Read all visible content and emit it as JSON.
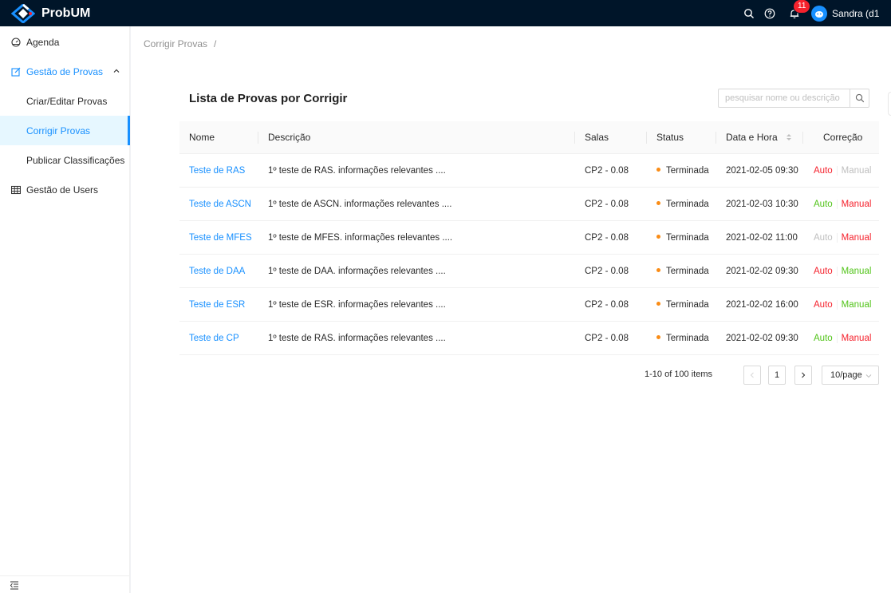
{
  "app": {
    "brand": "ProbUM",
    "user_name": "Sandra (d1",
    "notification_count": "11"
  },
  "colors": {
    "header_bg": "#001529",
    "primary": "#1890ff",
    "auto_red": "#f5222d",
    "manual_green": "#52c41a",
    "disabled": "#bfbfbf",
    "status_dot": "#fa8c16"
  },
  "sidebar": {
    "agenda": "Agenda",
    "gestao_provas": "Gestão de  Provas",
    "criar_editar": "Criar/Editar Provas",
    "corrigir": "Corrigir Provas",
    "publicar": "Publicar Classificações",
    "gestao_users": "Gestão de Users"
  },
  "breadcrumb": {
    "current": "Corrigir Provas",
    "separator": "/"
  },
  "list": {
    "title": "Lista de Provas por Corrigir",
    "search_placeholder": "pesquisar nome ou descrição"
  },
  "table": {
    "headers": {
      "nome": "Nome",
      "descricao": "Descrição",
      "salas": "Salas",
      "status": "Status",
      "data": "Data e Hora",
      "correcao": "Correção"
    },
    "rows": [
      {
        "nome": "Teste de RAS",
        "descricao": "1º teste de RAS. informações relevantes ....",
        "salas": "CP2 - 0.08",
        "status": "Terminada",
        "data": "2021-02-05 09:30",
        "auto": "Auto",
        "manual": "Manual",
        "auto_state": "red",
        "manual_state": "disabled"
      },
      {
        "nome": "Teste de ASCN",
        "descricao": "1º teste de ASCN. informações relevantes ....",
        "salas": "CP2 - 0.08",
        "status": "Terminada",
        "data": "2021-02-03 10:30",
        "auto": "Auto",
        "manual": "Manual",
        "auto_state": "green",
        "manual_state": "red"
      },
      {
        "nome": "Teste de  MFES",
        "descricao": "1º teste de MFES. informações relevantes ....",
        "salas": "CP2 - 0.08",
        "status": "Terminada",
        "data": "2021-02-02 11:00",
        "auto": "Auto",
        "manual": "Manual",
        "auto_state": "disabled",
        "manual_state": "red"
      },
      {
        "nome": "Teste de DAA",
        "descricao": "1º teste de DAA. informações relevantes ....",
        "salas": "CP2 - 0.08",
        "status": "Terminada",
        "data": "2021-02-02 09:30",
        "auto": "Auto",
        "manual": "Manual",
        "auto_state": "red",
        "manual_state": "green"
      },
      {
        "nome": "Teste de ESR",
        "descricao": "1º teste de ESR. informações relevantes ....",
        "salas": "CP2 - 0.08",
        "status": "Terminada",
        "data": "2021-02-02 16:00",
        "auto": "Auto",
        "manual": "Manual",
        "auto_state": "red",
        "manual_state": "green"
      },
      {
        "nome": "Teste de CP",
        "descricao": "1º teste de RAS. informações relevantes ....",
        "salas": "CP2 - 0.08",
        "status": "Terminada",
        "data": "2021-02-02 09:30",
        "auto": "Auto",
        "manual": "Manual",
        "auto_state": "green",
        "manual_state": "red"
      }
    ]
  },
  "pagination": {
    "total": "1-10 of 100 items",
    "current_page": "1",
    "page_size": "10/page"
  }
}
